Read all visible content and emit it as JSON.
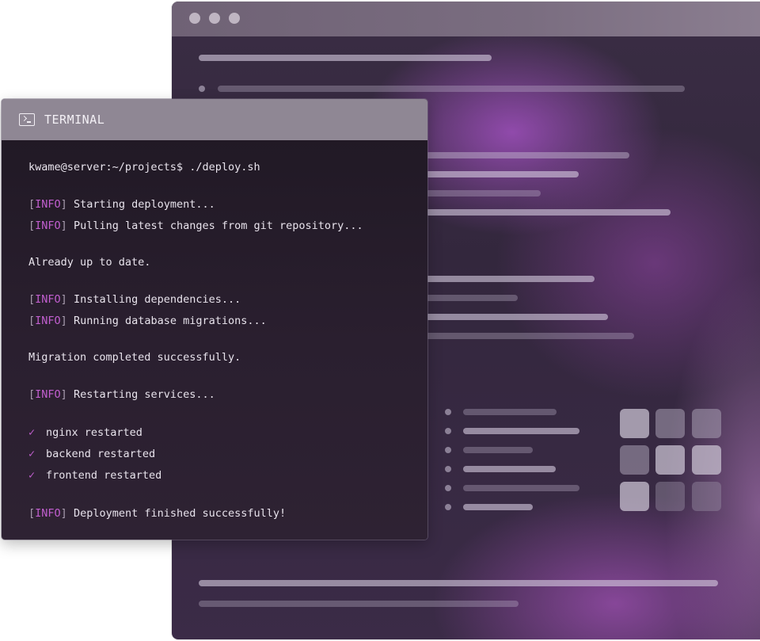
{
  "terminal": {
    "title": "TERMINAL",
    "prompt": "kwame@server:~/projects$ ./deploy.sh",
    "info_tag": "INFO",
    "lines": [
      "Starting deployment...",
      "Pulling latest changes from git repository...",
      "Already up to date.",
      "Installing dependencies...",
      "Running database migrations...",
      "Migration completed successfully.",
      "Restarting services...",
      "nginx restarted",
      "backend restarted",
      "frontend restarted",
      "Deployment finished successfully!"
    ]
  },
  "colors": {
    "accent": "#c25fd0",
    "terminal_bg": "#221a27",
    "terminal_header": "#8f8794",
    "browser_bg": "#382b42"
  },
  "icons": {
    "terminal": "terminal-prompt-icon",
    "check": "checkmark-icon"
  }
}
